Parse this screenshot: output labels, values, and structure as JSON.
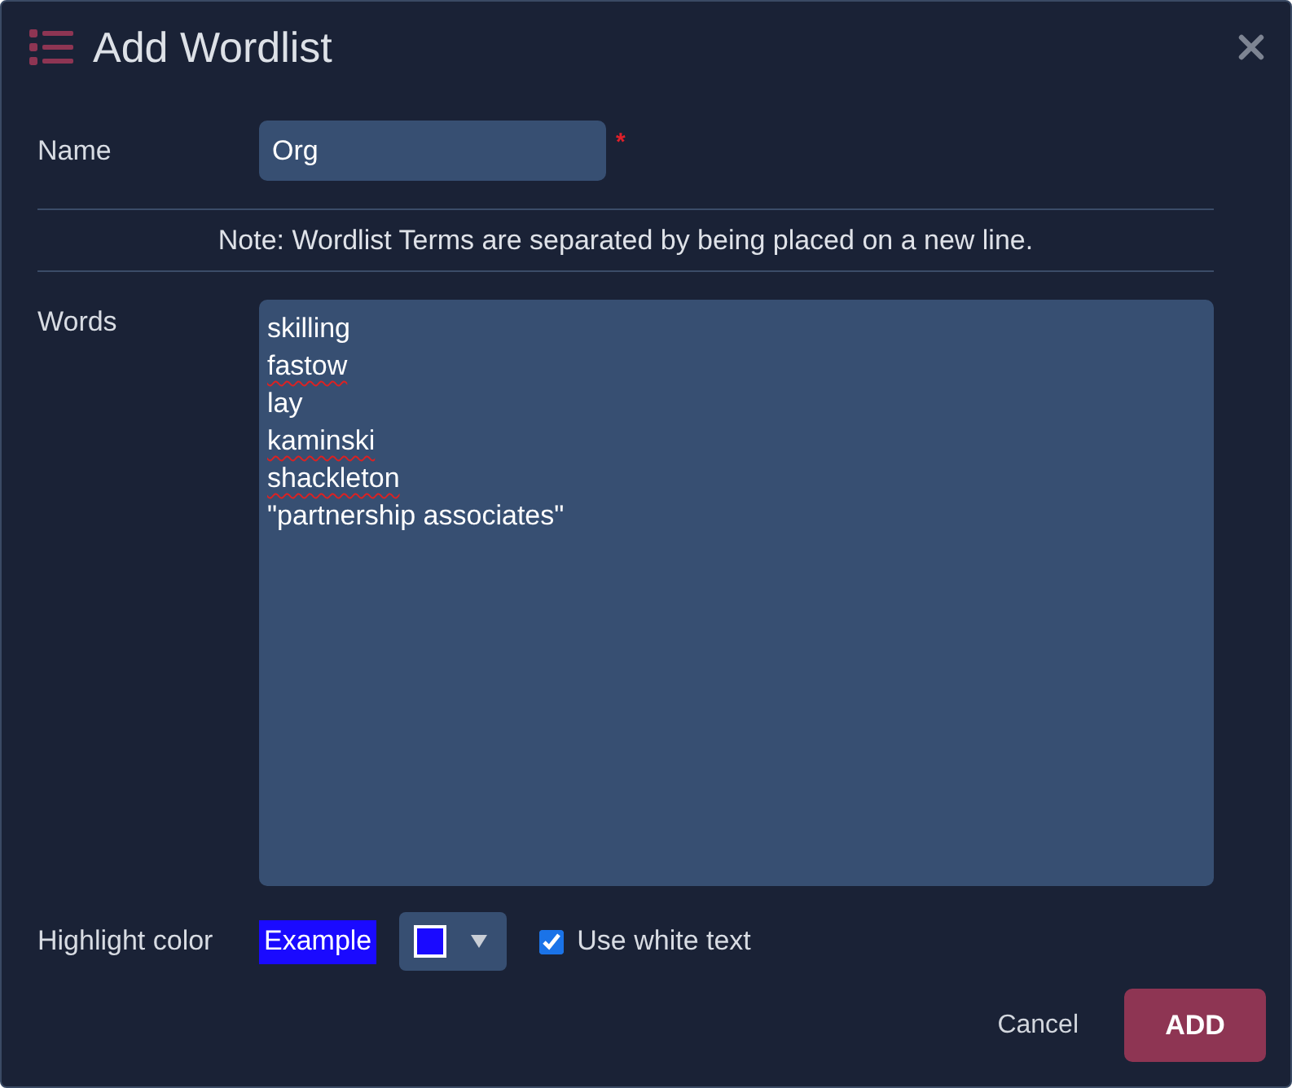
{
  "dialog": {
    "title": "Add Wordlist"
  },
  "name_field": {
    "label": "Name",
    "value": "Org",
    "required_mark": "*"
  },
  "note": "Note: Wordlist Terms are separated by being placed on a new line.",
  "words_field": {
    "label": "Words",
    "lines": [
      {
        "text": "skilling",
        "misspelled": false
      },
      {
        "text": "fastow",
        "misspelled": true
      },
      {
        "text": "lay",
        "misspelled": false
      },
      {
        "text": "kaminski",
        "misspelled": true
      },
      {
        "text": "shackleton",
        "misspelled": true
      },
      {
        "text": "\"partnership associates\"",
        "misspelled": false
      }
    ]
  },
  "highlight": {
    "label": "Highlight color",
    "example": "Example",
    "color": "#1a0aff",
    "use_white_text": {
      "label": "Use white text",
      "checked": true
    }
  },
  "buttons": [
    {
      "label": "Cancel",
      "kind": "text"
    },
    {
      "label": "ADD",
      "kind": "primary"
    }
  ]
}
